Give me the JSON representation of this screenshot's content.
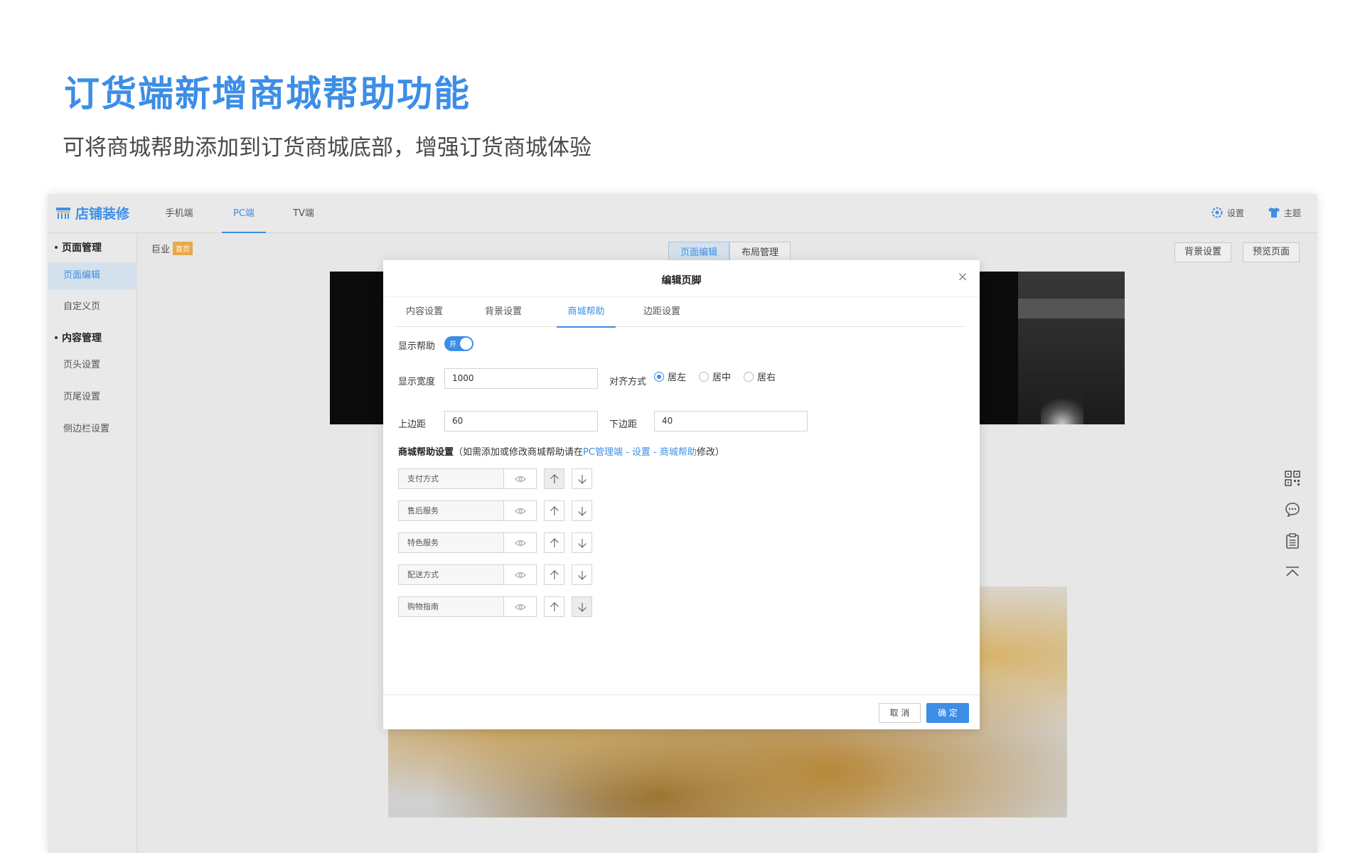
{
  "hero": {
    "title": "订货端新增商城帮助功能",
    "subtitle": "可将商城帮助添加到订货商城底部，增强订货商城体验"
  },
  "topbar": {
    "logo_text": "店铺装修",
    "tabs": [
      {
        "label": "手机端",
        "active": false
      },
      {
        "label": "PC端",
        "active": true
      },
      {
        "label": "TV端",
        "active": false
      }
    ],
    "settings_label": "设置",
    "theme_label": "主题"
  },
  "sidebar": {
    "groups": [
      {
        "label": "页面管理",
        "items": [
          {
            "label": "页面编辑",
            "active": true
          },
          {
            "label": "自定义页",
            "active": false
          }
        ]
      },
      {
        "label": "内容管理",
        "items": [
          {
            "label": "页头设置",
            "active": false
          },
          {
            "label": "页尾设置",
            "active": false
          },
          {
            "label": "侧边栏设置",
            "active": false
          }
        ]
      }
    ]
  },
  "workarea": {
    "breadcrumb": "巨业",
    "breadcrumb_badge": "首页",
    "segment": [
      {
        "label": "页面编辑",
        "active": true
      },
      {
        "label": "布局管理",
        "active": false
      }
    ],
    "bg_settings_button": "背景设置",
    "preview_button": "预览页面"
  },
  "modal": {
    "title": "编辑页脚",
    "tabs": [
      {
        "label": "内容设置",
        "active": false
      },
      {
        "label": "背景设置",
        "active": false
      },
      {
        "label": "商城帮助",
        "active": true
      },
      {
        "label": "边距设置",
        "active": false
      }
    ],
    "show_help_label": "显示帮助",
    "toggle_text": "开",
    "toggle_on": true,
    "width_label": "显示宽度",
    "width_value": "1000",
    "align_label": "对齐方式",
    "align_options": [
      "居左",
      "居中",
      "居右"
    ],
    "align_selected": "居左",
    "top_margin_label": "上边距",
    "top_margin_value": "60",
    "bottom_margin_label": "下边距",
    "bottom_margin_value": "40",
    "help_settings_title": "商城帮助设置",
    "help_settings_note_prefix": "（如需添加或修改商城帮助请在",
    "help_settings_note_link": "PC管理端 - 设置 - 商城帮助",
    "help_settings_note_suffix": "修改）",
    "help_items": [
      "支付方式",
      "售后服务",
      "特色服务",
      "配送方式",
      "购物指南"
    ],
    "cancel_label": "取 消",
    "ok_label": "确 定"
  },
  "colors": {
    "accent": "#3c8ee6",
    "badge": "#e8a94a"
  }
}
